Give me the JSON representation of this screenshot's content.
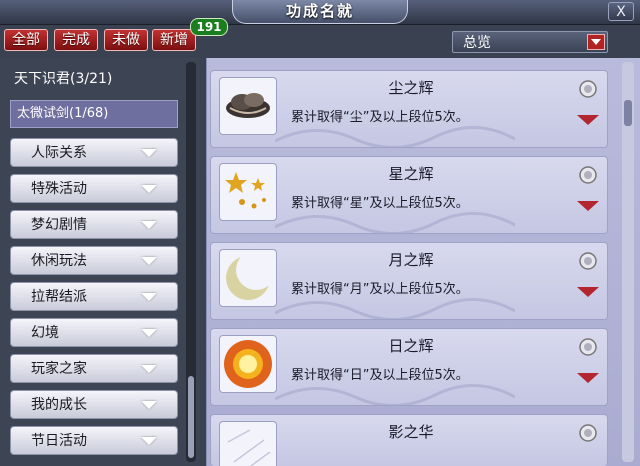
{
  "window": {
    "title": "功成名就",
    "close_label": "X"
  },
  "filters": [
    {
      "label": "全部"
    },
    {
      "label": "完成"
    },
    {
      "label": "未做"
    },
    {
      "label": "新增"
    }
  ],
  "new_count_badge": "191",
  "overview_select": {
    "value": "总览"
  },
  "sidebar": {
    "top_items": [
      {
        "label": "天下识君(3/21)"
      },
      {
        "label": "太微试剑(1/68)",
        "selected": true
      }
    ],
    "categories": [
      {
        "label": "人际关系"
      },
      {
        "label": "特殊活动"
      },
      {
        "label": "梦幻剧情"
      },
      {
        "label": "休闲玩法"
      },
      {
        "label": "拉帮结派"
      },
      {
        "label": "幻境"
      },
      {
        "label": "玩家之家"
      },
      {
        "label": "我的成长"
      },
      {
        "label": "节日活动"
      }
    ]
  },
  "achievements": [
    {
      "title": "尘之辉",
      "desc": "累计取得“尘”及以上段位5次。",
      "icon": "cloud-icon"
    },
    {
      "title": "星之辉",
      "desc": "累计取得“星”及以上段位5次。",
      "icon": "stars-icon"
    },
    {
      "title": "月之辉",
      "desc": "累计取得“月”及以上段位5次。",
      "icon": "moon-icon"
    },
    {
      "title": "日之辉",
      "desc": "累计取得“日”及以上段位5次。",
      "icon": "sun-icon"
    },
    {
      "title": "影之华",
      "desc": "",
      "icon": "shadow-icon"
    }
  ],
  "colors": {
    "accent_red": "#b3262f",
    "panel": "#c5c7e3",
    "badge_green": "#1a7d1e"
  }
}
